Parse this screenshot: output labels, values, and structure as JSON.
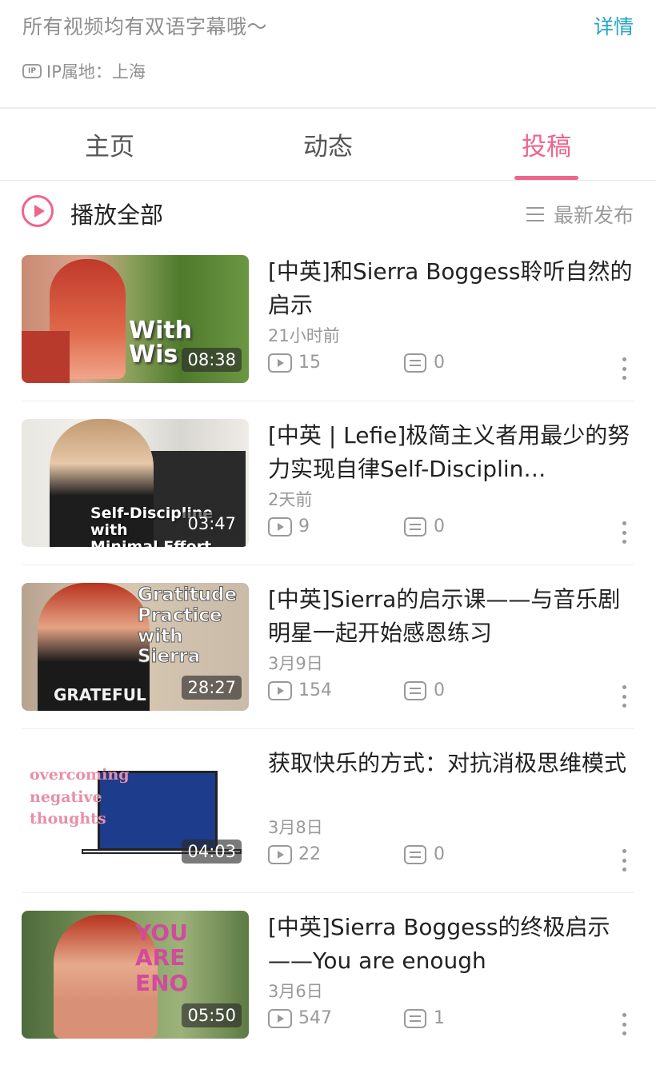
{
  "header": {
    "bio": "所有视频均有双语字幕哦～",
    "detail_link": "详情",
    "ip_icon_text": "IP",
    "ip_location": "IP属地：上海"
  },
  "tabs": [
    {
      "label": "主页"
    },
    {
      "label": "动态"
    },
    {
      "label": "投稿",
      "active": true
    }
  ],
  "actions": {
    "play_all": "播放全部",
    "sort": "最新发布"
  },
  "videos": [
    {
      "title": "[中英]和Sierra Boggess聆听自然的启示",
      "date": "21小时前",
      "views": "15",
      "comments": "0",
      "duration": "08:38",
      "thumb_text": "With\nWis"
    },
    {
      "title": "[中英 | Lefie]极简主义者用最少的努力实现自律Self-Disciplin…",
      "date": "2天前",
      "views": "9",
      "comments": "0",
      "duration": "03:47",
      "thumb_text": "Self-Discipline\nwith\nMinimal Effort"
    },
    {
      "title": "[中英]Sierra的启示课——与音乐剧明星一起开始感恩练习",
      "date": "3月9日",
      "views": "154",
      "comments": "0",
      "duration": "28:27",
      "thumb_text": "Gratitude\nPractice\nwith\nSierra",
      "shirt_text": "GRATEFUL"
    },
    {
      "title": "获取快乐的方式：对抗消极思维模式",
      "date": "3月8日",
      "views": "22",
      "comments": "0",
      "duration": "04:03",
      "thumb_text": "overcoming\nnegative\nthoughts"
    },
    {
      "title": "[中英]Sierra Boggess的终极启示——You are enough",
      "date": "3月6日",
      "views": "547",
      "comments": "1",
      "duration": "05:50",
      "thumb_text": "YOU\nARE\nENO"
    }
  ],
  "colors": {
    "accent": "#f0648c",
    "link": "#23a3c5",
    "muted": "#999999"
  }
}
